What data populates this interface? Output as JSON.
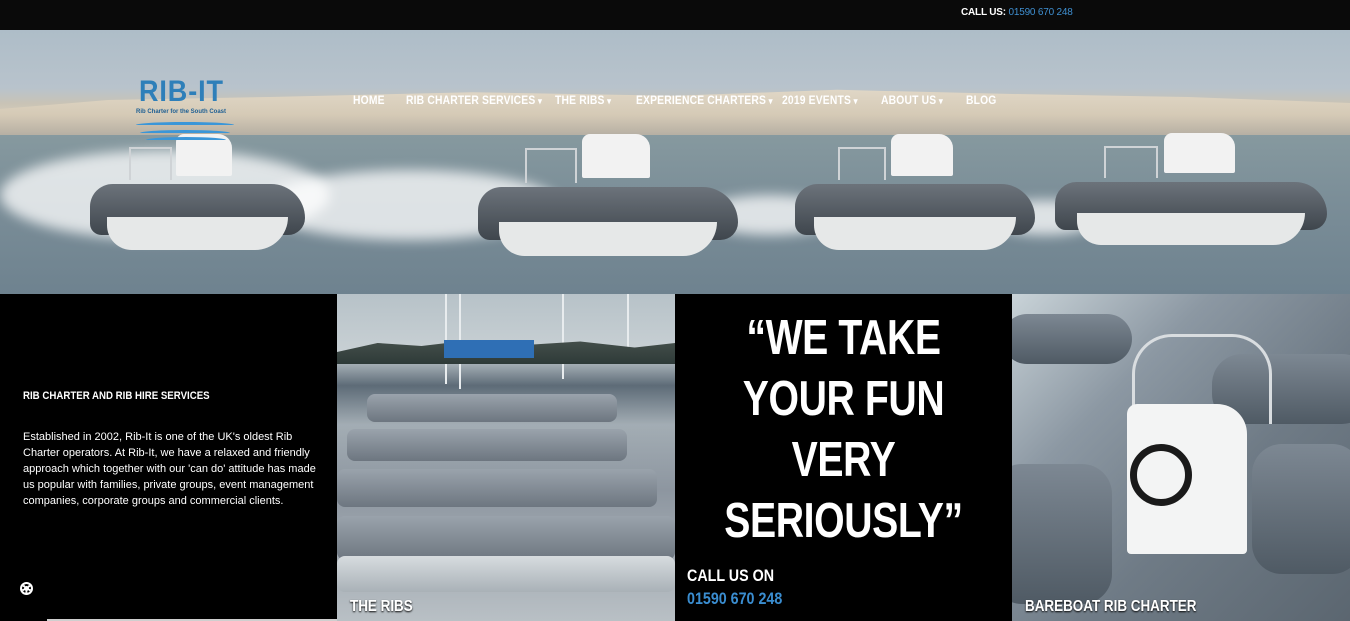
{
  "topbar": {
    "call_label": "CALL US:",
    "call_number": "01590 670 248"
  },
  "logo": {
    "wordmark": "RIB-IT",
    "tagline": "Rib Charter for the South Coast"
  },
  "nav": {
    "items": [
      {
        "label": "HOME",
        "dropdown": false
      },
      {
        "label": "RIB CHARTER SERVICES",
        "dropdown": true
      },
      {
        "label": "THE RIBS",
        "dropdown": true
      },
      {
        "label": "EXPERIENCE CHARTERS",
        "dropdown": true
      },
      {
        "label": "2019 EVENTS",
        "dropdown": true
      },
      {
        "label": "ABOUT US",
        "dropdown": true
      },
      {
        "label": "BLOG",
        "dropdown": false
      }
    ],
    "chevron": "▾"
  },
  "intro": {
    "heading": "RIB CHARTER AND RIB HIRE SERVICES",
    "body": "Established in 2002, Rib-It is one of the UK's oldest Rib Charter operators. At Rib-It, we have a relaxed and friendly approach which together with our 'can do' attitude has made us popular with families, private groups, event management companies, corporate groups and commercial clients."
  },
  "tiles": {
    "ribs_label": "THE RIBS",
    "quote": "“WE TAKE YOUR FUN VERY SERIOUSLY”",
    "call_label": "CALL US ON",
    "call_number": "01590 670 248",
    "bareboat_label": "BAREBOAT RIB CHARTER"
  },
  "colors": {
    "accent_blue": "#3a8dd0",
    "background": "#000000",
    "topbar": "#0a0a0a"
  }
}
